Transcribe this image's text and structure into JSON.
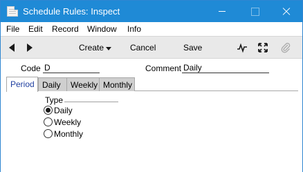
{
  "window": {
    "title": "Schedule Rules: Inspect",
    "controls": {
      "minimize": "minimize",
      "maximize": "maximize",
      "close": "close"
    }
  },
  "menu": {
    "items": [
      "File",
      "Edit",
      "Record",
      "Window",
      "Info"
    ]
  },
  "toolbar": {
    "back_icon": "back-arrow-icon",
    "forward_icon": "forward-arrow-icon",
    "create_label": "Create",
    "cancel_label": "Cancel",
    "save_label": "Save",
    "activity_icon": "activity-icon",
    "expand_icon": "expand-icon",
    "attach_icon": "paperclip-icon"
  },
  "header": {
    "code_label": "Code",
    "code_value": "D",
    "comment_label": "Comment",
    "comment_value": "Daily"
  },
  "tabs": {
    "items": [
      "Period",
      "Daily",
      "Weekly",
      "Monthly"
    ],
    "active": "Period"
  },
  "period": {
    "type_label": "Type",
    "options": [
      "Daily",
      "Weekly",
      "Monthly"
    ],
    "selected": "Daily"
  },
  "colors": {
    "titlebar": "#1f8ad6",
    "toolbar": "#e9e9e9",
    "active_tab_text": "#1f3fa0",
    "inactive_tab": "#cfcfcf"
  }
}
